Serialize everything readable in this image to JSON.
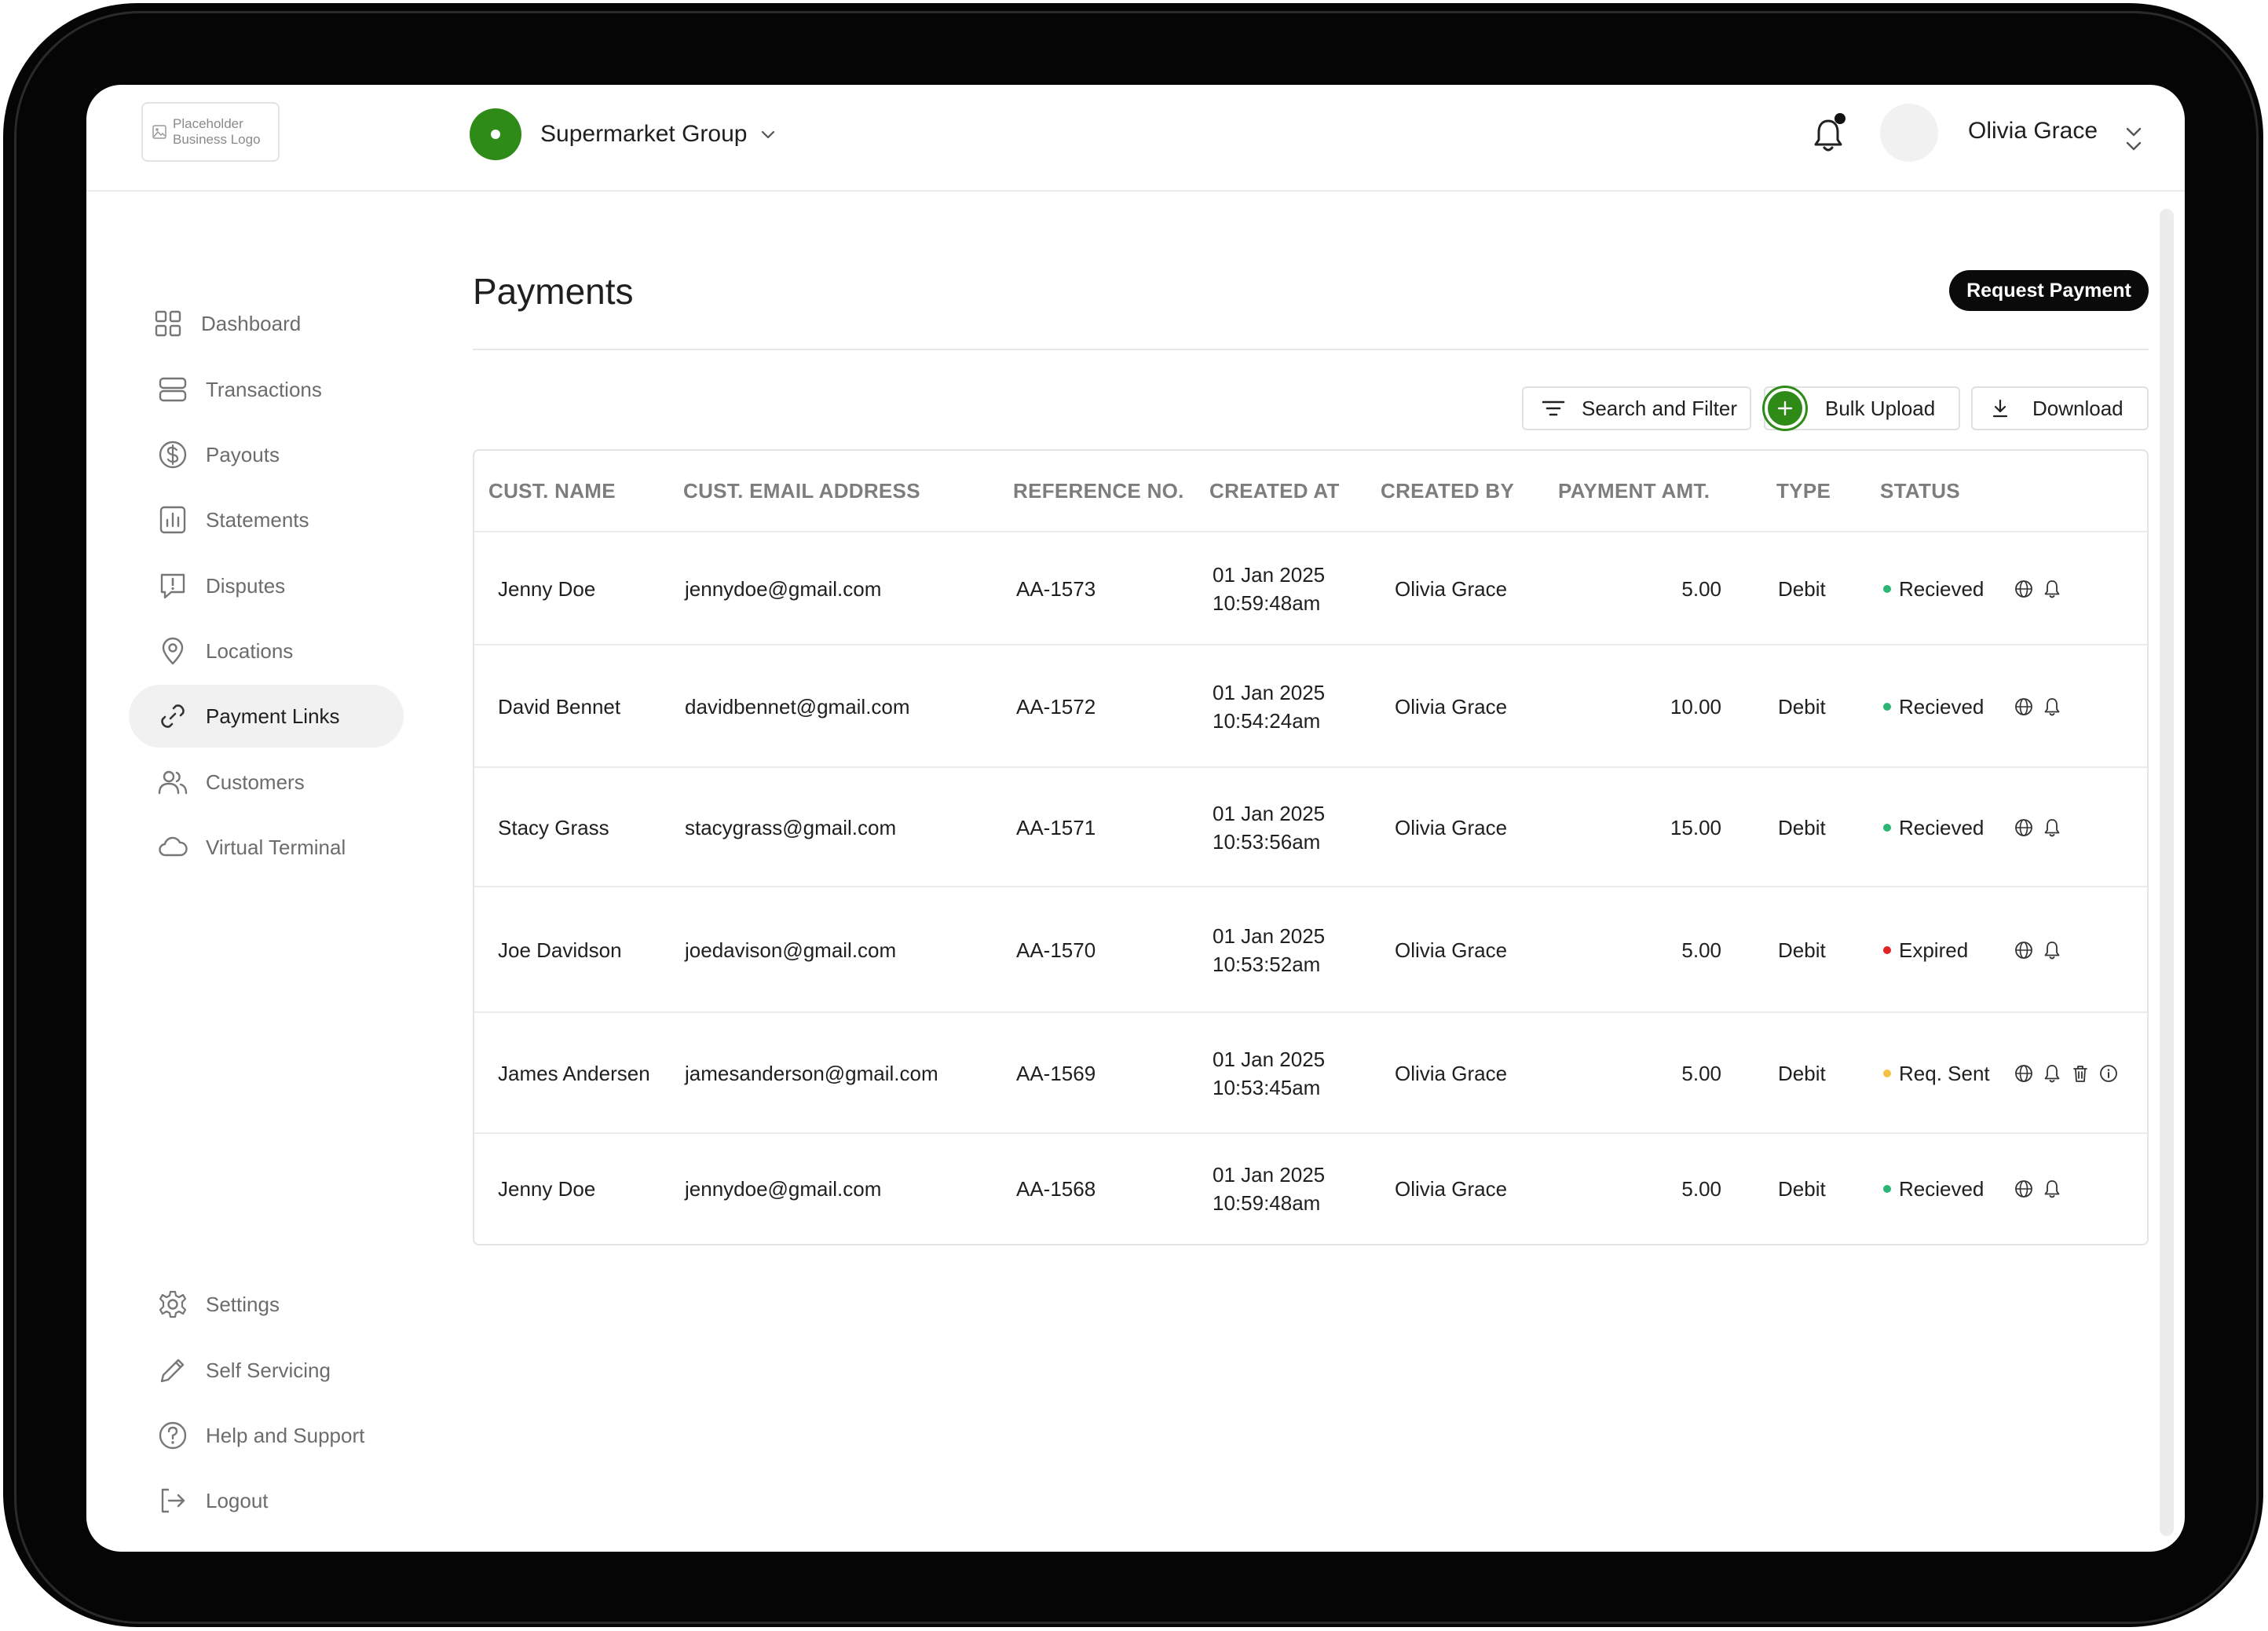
{
  "header": {
    "logo_text": "Placeholder Business Logo",
    "org_name": "Supermarket Group",
    "user_name": "Olivia Grace"
  },
  "sidebar": {
    "items": [
      {
        "label": "Dashboard",
        "icon": "grid-icon"
      },
      {
        "label": "Transactions",
        "icon": "rows-icon"
      },
      {
        "label": "Payouts",
        "icon": "dollar-circle-icon"
      },
      {
        "label": "Statements",
        "icon": "chart-icon"
      },
      {
        "label": "Disputes",
        "icon": "alert-message-icon"
      },
      {
        "label": "Locations",
        "icon": "map-pin-icon"
      },
      {
        "label": "Payment Links",
        "icon": "link-icon",
        "active": true
      },
      {
        "label": "Customers",
        "icon": "users-icon"
      },
      {
        "label": "Virtual Terminal",
        "icon": "cloud-icon"
      }
    ],
    "bottom_items": [
      {
        "label": "Settings",
        "icon": "gear-icon"
      },
      {
        "label": "Self Servicing",
        "icon": "pencil-icon"
      },
      {
        "label": "Help and Support",
        "icon": "help-circle-icon"
      },
      {
        "label": "Logout",
        "icon": "logout-icon"
      }
    ]
  },
  "main": {
    "title": "Payments",
    "request_button": "Request Payment",
    "toolbar": {
      "search_filter": "Search and Filter",
      "bulk_upload": "Bulk Upload",
      "download": "Download"
    },
    "table": {
      "columns": [
        "CUST. NAME",
        "CUST. EMAIL ADDRESS",
        "REFERENCE NO.",
        "CREATED AT",
        "CREATED BY",
        "PAYMENT AMT.",
        "TYPE",
        "STATUS"
      ],
      "rows": [
        {
          "name": "Jenny Doe",
          "email": "jennydoe@gmail.com",
          "ref": "AA-1573",
          "date": "01 Jan 2025",
          "time": "10:59:48am",
          "created_by": "Olivia Grace",
          "amount": "5.00",
          "type": "Debit",
          "status": "Recieved",
          "status_color": "#2bb673",
          "actions": [
            "globe-icon",
            "bell-icon"
          ]
        },
        {
          "name": "David Bennet",
          "email": "davidbennet@gmail.com",
          "ref": "AA-1572",
          "date": "01 Jan 2025",
          "time": "10:54:24am",
          "created_by": "Olivia Grace",
          "amount": "10.00",
          "type": "Debit",
          "status": "Recieved",
          "status_color": "#2bb673",
          "actions": [
            "globe-icon",
            "bell-icon"
          ]
        },
        {
          "name": "Stacy Grass",
          "email": "stacygrass@gmail.com",
          "ref": "AA-1571",
          "date": "01 Jan 2025",
          "time": "10:53:56am",
          "created_by": "Olivia Grace",
          "amount": "15.00",
          "type": "Debit",
          "status": "Recieved",
          "status_color": "#2bb673",
          "actions": [
            "globe-icon",
            "bell-icon"
          ]
        },
        {
          "name": "Joe Davidson",
          "email": "joedavison@gmail.com",
          "ref": "AA-1570",
          "date": "01 Jan 2025",
          "time": "10:53:52am",
          "created_by": "Olivia Grace",
          "amount": "5.00",
          "type": "Debit",
          "status": "Expired",
          "status_color": "#e02424",
          "actions": [
            "globe-icon",
            "bell-icon"
          ]
        },
        {
          "name": "James Andersen",
          "email": "jamesanderson@gmail.com",
          "ref": "AA-1569",
          "date": "01 Jan 2025",
          "time": "10:53:45am",
          "created_by": "Olivia Grace",
          "amount": "5.00",
          "type": "Debit",
          "status": "Req. Sent",
          "status_color": "#f5c242",
          "actions": [
            "globe-icon",
            "bell-icon",
            "trash-icon",
            "info-icon"
          ]
        },
        {
          "name": "Jenny Doe",
          "email": "jennydoe@gmail.com",
          "ref": "AA-1568",
          "date": "01 Jan 2025",
          "time": "10:59:48am",
          "created_by": "Olivia Grace",
          "amount": "5.00",
          "type": "Debit",
          "status": "Recieved",
          "status_color": "#2bb673",
          "actions": [
            "globe-icon",
            "bell-icon"
          ]
        }
      ]
    }
  },
  "colors": {
    "brand": "#2e8b17",
    "primary_button": "#0a0a0a"
  }
}
